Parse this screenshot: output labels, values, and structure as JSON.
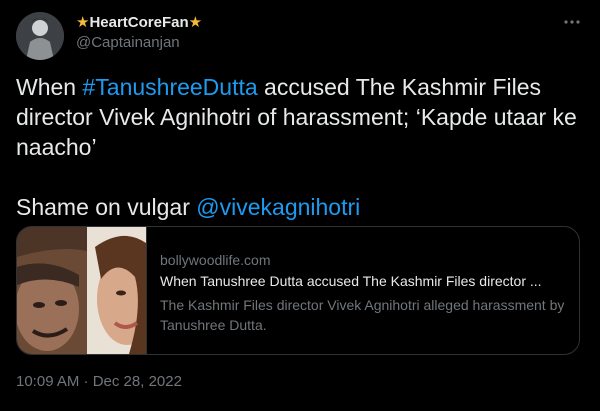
{
  "author": {
    "star_left": "★",
    "name": "HeartCoreFan",
    "star_right": "★",
    "handle": "@Captainanjan"
  },
  "more_icon": "more-horizontal-icon",
  "tweet": {
    "line1_prefix": "When ",
    "hashtag": "#TanushreeDutta",
    "line1_rest": " accused The Kashmir Files director Vivek Agnihotri of harassment; ‘Kapde utaar ke naacho’",
    "line2_prefix": "Shame on vulgar ",
    "mention": "@vivekagnihotri"
  },
  "card": {
    "domain": "bollywoodlife.com",
    "title": "When Tanushree Dutta accused The Kashmir Files director ...",
    "description": "The Kashmir Files director Vivek Agnihotri alleged harassment by Tanushree Dutta."
  },
  "meta": {
    "timestamp": "10:09 AM · Dec 28, 2022"
  },
  "colors": {
    "background": "#000000",
    "text": "#e7e9ea",
    "secondary": "#71767b",
    "link": "#1d9bf0",
    "border": "#2f3336",
    "star": "#f6b93b"
  }
}
